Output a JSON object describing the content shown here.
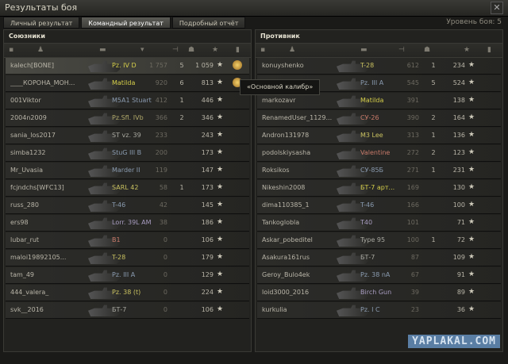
{
  "window": {
    "title": "Результаты боя",
    "level": "Уровень боя: 5"
  },
  "tabs": [
    {
      "label": "Личный результат"
    },
    {
      "label": "Командный результат",
      "active": true
    },
    {
      "label": "Подробный отчёт"
    }
  ],
  "allies": {
    "title": "Союзники",
    "rows": [
      {
        "player": "kalech[BONE]",
        "tank": "Pz. IV D",
        "tank_color": "#d6cf4a",
        "dmg": "1 757",
        "frags": "5",
        "xp": "1 059",
        "highlight": true
      },
      {
        "player": "____КОРОНА_МОН...",
        "tank": "Matilda",
        "tank_color": "#d6cf4a",
        "dmg": "920",
        "frags": "6",
        "xp": "813"
      },
      {
        "player": "001Viktor",
        "tank": "M5A1 Stuart",
        "tank_color": "#8a9bb0",
        "dmg": "412",
        "frags": "1",
        "xp": "446"
      },
      {
        "player": "2004n2009",
        "tank": "Pz.Sfl. IVb",
        "tank_color": "#b0a86a",
        "dmg": "366",
        "frags": "2",
        "xp": "346"
      },
      {
        "player": "sania_los2017",
        "tank": "ST vz. 39",
        "tank_color": "#a8a8a0",
        "dmg": "233",
        "frags": "",
        "xp": "243"
      },
      {
        "player": "simba1232",
        "tank": "StuG III B",
        "tank_color": "#8a9bb0",
        "dmg": "200",
        "frags": "",
        "xp": "173"
      },
      {
        "player": "Mr_Uvasia",
        "tank": "Marder II",
        "tank_color": "#8a9bb0",
        "dmg": "119",
        "frags": "",
        "xp": "147"
      },
      {
        "player": "fcjndchs[WFC13]",
        "tank": "SARL 42",
        "tank_color": "#c8c060",
        "dmg": "58",
        "frags": "1",
        "xp": "173"
      },
      {
        "player": "russ_280",
        "tank": "T-46",
        "tank_color": "#8a9bb0",
        "dmg": "42",
        "frags": "",
        "xp": "145"
      },
      {
        "player": "ers98",
        "tank": "Lorr. 39L AM",
        "tank_color": "#a89cc0",
        "dmg": "38",
        "frags": "",
        "xp": "186"
      },
      {
        "player": "lubar_rut",
        "tank": "B1",
        "tank_color": "#c87a6a",
        "dmg": "0",
        "frags": "",
        "xp": "106"
      },
      {
        "player": "maloi19892105...",
        "tank": "T-28",
        "tank_color": "#c8c060",
        "dmg": "0",
        "frags": "",
        "xp": "179"
      },
      {
        "player": "tam_49",
        "tank": "Pz. III A",
        "tank_color": "#8a9bb0",
        "dmg": "0",
        "frags": "",
        "xp": "129"
      },
      {
        "player": "444_valera_",
        "tank": "Pz. 38 (t)",
        "tank_color": "#c8c060",
        "dmg": "0",
        "frags": "",
        "xp": "224"
      },
      {
        "player": "svk__2016",
        "tank": "БТ-7",
        "tank_color": "#a8a8a0",
        "dmg": "0",
        "frags": "",
        "xp": "106"
      }
    ]
  },
  "enemies": {
    "title": "Противник",
    "rows": [
      {
        "player": "konuyshenko",
        "tank": "T-28",
        "tank_color": "#c8c060",
        "dmg": "612",
        "frags": "1",
        "xp": "234"
      },
      {
        "player": "",
        "tank": "Pz. III A",
        "tank_color": "#8a9bb0",
        "dmg": "545",
        "frags": "5",
        "xp": "524"
      },
      {
        "player": "markozavr",
        "tank": "Matilda",
        "tank_color": "#d6cf4a",
        "dmg": "391",
        "frags": "",
        "xp": "138"
      },
      {
        "player": "RenamedUser_1129...",
        "tank": "СУ-26",
        "tank_color": "#c87a6a",
        "dmg": "390",
        "frags": "2",
        "xp": "164"
      },
      {
        "player": "Andron131978",
        "tank": "M3 Lee",
        "tank_color": "#c8c060",
        "dmg": "313",
        "frags": "1",
        "xp": "136"
      },
      {
        "player": "podolskiysasha",
        "tank": "Valentine",
        "tank_color": "#c87a6a",
        "dmg": "272",
        "frags": "2",
        "xp": "123"
      },
      {
        "player": "Roksikos",
        "tank": "СУ-85Б",
        "tank_color": "#8a9bb0",
        "dmg": "271",
        "frags": "1",
        "xp": "231"
      },
      {
        "player": "Nikeshin2008",
        "tank": "БТ-7 арт...",
        "tank_color": "#d6cf4a",
        "dmg": "169",
        "frags": "",
        "xp": "130"
      },
      {
        "player": "dima110385_1",
        "tank": "T-46",
        "tank_color": "#8a9bb0",
        "dmg": "166",
        "frags": "",
        "xp": "100"
      },
      {
        "player": "Tankoglobla",
        "tank": "T40",
        "tank_color": "#a89cc0",
        "dmg": "101",
        "frags": "",
        "xp": "71"
      },
      {
        "player": "Askar_pobeditel",
        "tank": "Type 95",
        "tank_color": "#a8a8a0",
        "dmg": "100",
        "frags": "1",
        "xp": "72"
      },
      {
        "player": "Asakura161rus",
        "tank": "БТ-7",
        "tank_color": "#a8a8a0",
        "dmg": "87",
        "frags": "",
        "xp": "109"
      },
      {
        "player": "Gerоy_Bulo4ek",
        "tank": "Pz. 38 nA",
        "tank_color": "#8a9bb0",
        "dmg": "67",
        "frags": "",
        "xp": "91"
      },
      {
        "player": "loid3000_2016",
        "tank": "Birch Gun",
        "tank_color": "#a89cc0",
        "dmg": "39",
        "frags": "",
        "xp": "89"
      },
      {
        "player": "kurkulia",
        "tank": "Pz. I C",
        "tank_color": "#8a9bb0",
        "dmg": "23",
        "frags": "",
        "xp": "36"
      }
    ]
  },
  "tooltip": "«Основной калибр»",
  "watermark": "YAPLAKAL.COM"
}
